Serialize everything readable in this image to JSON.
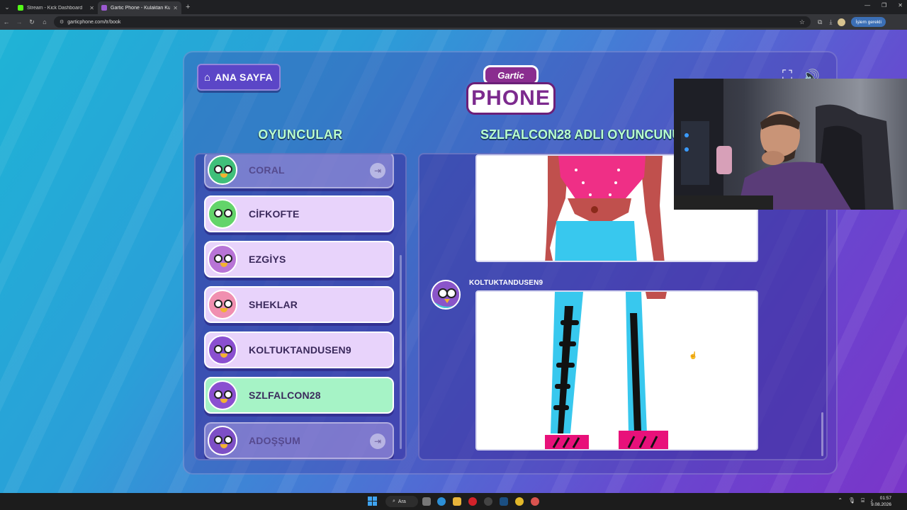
{
  "browser": {
    "tabs": [
      {
        "title": "Stream - Kick Dashboard",
        "favicon_color": "#53fc18",
        "active": false
      },
      {
        "title": "Gartic Phone - Kulaktan Kulağa",
        "favicon_color": "#9b59d0",
        "active": true
      }
    ],
    "url": "garticphone.com/tr/book",
    "profile_label": "İşlem gerekli"
  },
  "header": {
    "home_label": "ANA SAYFA",
    "logo_top": "Gartic",
    "logo_main": "PHONE"
  },
  "players_title": "OYUNCULAR",
  "album_title": "SZLFALCON28 ADLI OYUNCUNUN ALBÜMÜ",
  "players": [
    {
      "name": "CORAL",
      "state": "left",
      "avatar_color": "#3fbf7a"
    },
    {
      "name": "CİFKOFTE",
      "state": "normal",
      "avatar_color": "#63d46a"
    },
    {
      "name": "EZGİYS",
      "state": "normal",
      "avatar_color": "#b874d6"
    },
    {
      "name": "SHEKLAR",
      "state": "normal",
      "avatar_color": "#f08fb0"
    },
    {
      "name": "KOLTUKTANDUSEN9",
      "state": "normal",
      "avatar_color": "#8a4fd0"
    },
    {
      "name": "SZLFALCON28",
      "state": "active",
      "avatar_color": "#8a4fd0"
    },
    {
      "name": "ADOŞŞUM",
      "state": "left",
      "avatar_color": "#7d4fc6"
    }
  ],
  "album": {
    "entry_author": "KOLTUKTANDUSEN9"
  },
  "taskbar": {
    "search_label": "Ara",
    "time": "01:57",
    "date": "9.08.2026"
  }
}
